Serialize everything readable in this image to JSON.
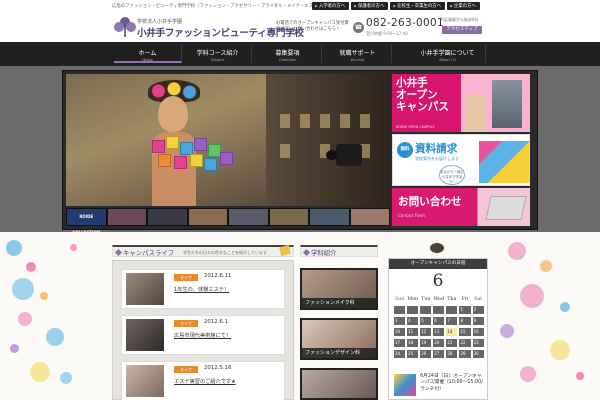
{
  "topbar": {
    "tagline": "広島のファッション・ビューティ専門学校（ファッション・アクセサリー・ブライダル・メイク・エステ）",
    "links": [
      "入学者の方へ",
      "保護者の方へ",
      "在校生・卒業生の方へ",
      "企業の方へ"
    ]
  },
  "header": {
    "logo_small": "学校法人小井手学園",
    "logo_main": "小井手ファッションビューティ専門学校",
    "message": "お電話でのオープンキャンパス受付資料請求・お問い合わせはこちら！",
    "phone": "082-263-0001",
    "hours": "受付時間 9:00～17:00",
    "access_note": "JR広島駅から徒歩6分",
    "access_button": "アクセスマップ",
    "logo_color": "#4b3b72"
  },
  "nav": [
    {
      "jp": "ホーム",
      "en": "Home"
    },
    {
      "jp": "学科コース紹介",
      "en": "Subject"
    },
    {
      "jp": "募集要項",
      "en": "Guideline"
    },
    {
      "jp": "就職サポート",
      "en": "Recruit"
    },
    {
      "jp": "小井手学園について",
      "en": "About Us"
    }
  ],
  "hero": {
    "thumb_label": "KOIDE COLLECTION",
    "open_campus": {
      "title": "小井手\nオープン\nキャンパス",
      "sub": "KOIDE OPEN CAMPUS"
    },
    "document": {
      "badge": "無料",
      "title": "資料請求",
      "sub": "学校案内をお届けします",
      "bubble": "あなたも一緒に小井手で学ぼう！"
    },
    "contact": {
      "title": "お問い合わせ",
      "sub": "Contact Form"
    },
    "accent_pink": "#d6156c",
    "accent_blue": "#2a8fd6"
  },
  "campus_life": {
    "title": "キャンパスライフ",
    "description": "学生たちの日々の色々なことを紹介しています",
    "entries": [
      {
        "tag": "ライフ",
        "date": "2012.6.11",
        "title": "1年生の、体験エステ！"
      },
      {
        "tag": "ライフ",
        "date": "2012.6.1",
        "title": "広島市現代美術館にて！"
      },
      {
        "tag": "ライフ",
        "date": "2012.5.16",
        "title": "エステ実習のご紹介です★"
      }
    ],
    "tag_color": "#e98a2c"
  },
  "subjects": {
    "title": "学科紹介",
    "items": [
      "ファッションメイク科",
      "ファッションデザイン科",
      ""
    ]
  },
  "calendar": {
    "header": "オープンキャンパスの日程",
    "month": "6",
    "day_names": [
      "Sun",
      "Mon",
      "Tue",
      "Wed",
      "Thu",
      "Fri",
      "Sat"
    ],
    "days": [
      "",
      "",
      "",
      "",
      "",
      "1",
      "2",
      "3",
      "4",
      "5",
      "6",
      "7",
      "8",
      "9",
      "10",
      "11",
      "12",
      "13",
      "14",
      "15",
      "16",
      "17",
      "18",
      "19",
      "20",
      "21",
      "22",
      "23",
      "24",
      "25",
      "26",
      "27",
      "28",
      "29",
      "30"
    ],
    "highlight_day": "14",
    "event_text": "6月24日（日）オープンキャンパス開催（10:00～15:00/ランチ付）"
  }
}
